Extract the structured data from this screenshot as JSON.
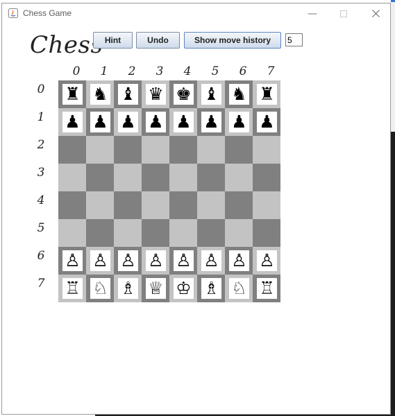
{
  "window": {
    "title": "Chess Game"
  },
  "header": {
    "title": "Chess"
  },
  "toolbar": {
    "hint_label": "Hint",
    "undo_label": "Undo",
    "history_label": "Show move history",
    "moves_value": "5"
  },
  "board": {
    "col_labels": [
      "0",
      "1",
      "2",
      "3",
      "4",
      "5",
      "6",
      "7"
    ],
    "row_labels": [
      "0",
      "1",
      "2",
      "3",
      "4",
      "5",
      "6",
      "7"
    ],
    "colors": {
      "light": "#c3c3c3",
      "dark": "#808080"
    },
    "pieces": [
      [
        "black-rook",
        "black-knight",
        "black-bishop",
        "black-queen",
        "black-king",
        "black-bishop",
        "black-knight",
        "black-rook"
      ],
      [
        "black-pawn",
        "black-pawn",
        "black-pawn",
        "black-pawn",
        "black-pawn",
        "black-pawn",
        "black-pawn",
        "black-pawn"
      ],
      [
        "",
        "",
        "",
        "",
        "",
        "",
        "",
        ""
      ],
      [
        "",
        "",
        "",
        "",
        "",
        "",
        "",
        ""
      ],
      [
        "",
        "",
        "",
        "",
        "",
        "",
        "",
        ""
      ],
      [
        "",
        "",
        "",
        "",
        "",
        "",
        "",
        ""
      ],
      [
        "white-pawn",
        "white-pawn",
        "white-pawn",
        "white-pawn",
        "white-pawn",
        "white-pawn",
        "white-pawn",
        "white-pawn"
      ],
      [
        "white-rook",
        "white-knight",
        "white-bishop",
        "white-queen",
        "white-king",
        "white-bishop",
        "white-knight",
        "white-rook"
      ]
    ]
  }
}
